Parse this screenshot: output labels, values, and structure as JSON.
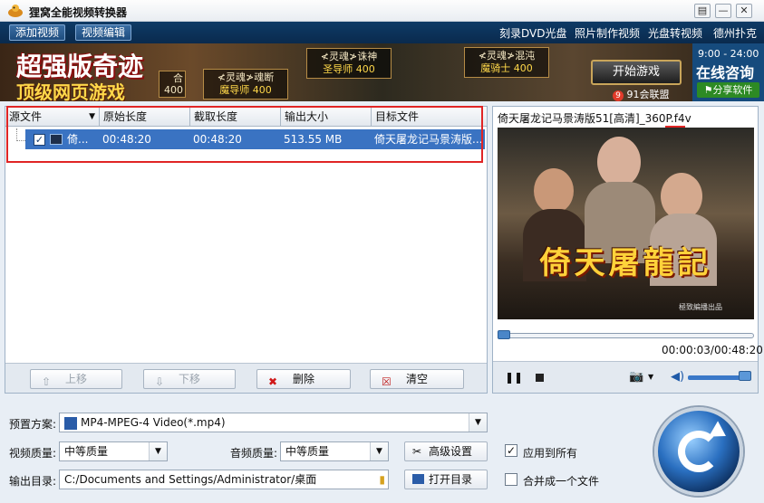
{
  "window": {
    "title": "狸窝全能视频转换器",
    "buttons": [
      "▤",
      "—",
      "✕"
    ]
  },
  "nav": {
    "tabs": [
      "添加视频",
      "视频编辑"
    ],
    "links": [
      "刻录DVD光盘",
      "照片制作视频",
      "光盘转视频",
      "德州扑克"
    ]
  },
  "banner": {
    "headline": "超强版奇迹",
    "subline": "顶级网页游戏",
    "cards": [
      {
        "name": "≮灵魂≯魂断",
        "level": "魔导师 400"
      },
      {
        "name": "≮灵魂≯诛神",
        "level": "圣导师 400"
      },
      {
        "name": "≮灵魂≯混沌",
        "level": "魔骑士 400"
      }
    ],
    "partial_text": [
      "合",
      "400"
    ],
    "start_game": "开始游戏",
    "union": "91会联盟",
    "union_badge": "9",
    "ad_time": "9:00 - 24:00",
    "ad_consult": "在线咨询",
    "ad_share": "分享软件"
  },
  "file_list": {
    "columns": [
      "源文件",
      "原始长度",
      "截取长度",
      "输出大小",
      "目标文件"
    ],
    "rows": [
      {
        "checked": true,
        "source": "倚...",
        "original_length": "00:48:20",
        "cut_length": "00:48:20",
        "output_size": "513.55 MB",
        "target": "倚天屠龙记马景涛版..."
      }
    ],
    "buttons": {
      "up": "上移",
      "down": "下移",
      "delete": "删除",
      "clear": "清空"
    }
  },
  "preview": {
    "title": "倚天屠龙记马景涛版51[高清]_360P.f4v",
    "caption": "倚天屠龍記",
    "watermark": "極致編播出品",
    "time": "00:00:03/00:48:20",
    "progress": 0.001,
    "volume": 1.0
  },
  "settings": {
    "preset_label": "预置方案:",
    "preset_value": "MP4-MPEG-4 Video(*.mp4)",
    "video_quality_label": "视频质量:",
    "video_quality_value": "中等质量",
    "audio_quality_label": "音频质量:",
    "audio_quality_value": "中等质量",
    "advanced_button": "高级设置",
    "apply_all_label": "应用到所有",
    "apply_all_checked": true,
    "output_dir_label": "输出目录:",
    "output_dir_value": "C:/Documents and Settings/Administrator/桌面",
    "open_dir_button": "打开目录",
    "merge_label": "合并成一个文件",
    "merge_checked": false
  },
  "colors": {
    "nav_bg": "#0e3a66",
    "selection": "#3a73c2",
    "highlight_box": "#e02525",
    "convert_button": "#2a6fc0"
  }
}
